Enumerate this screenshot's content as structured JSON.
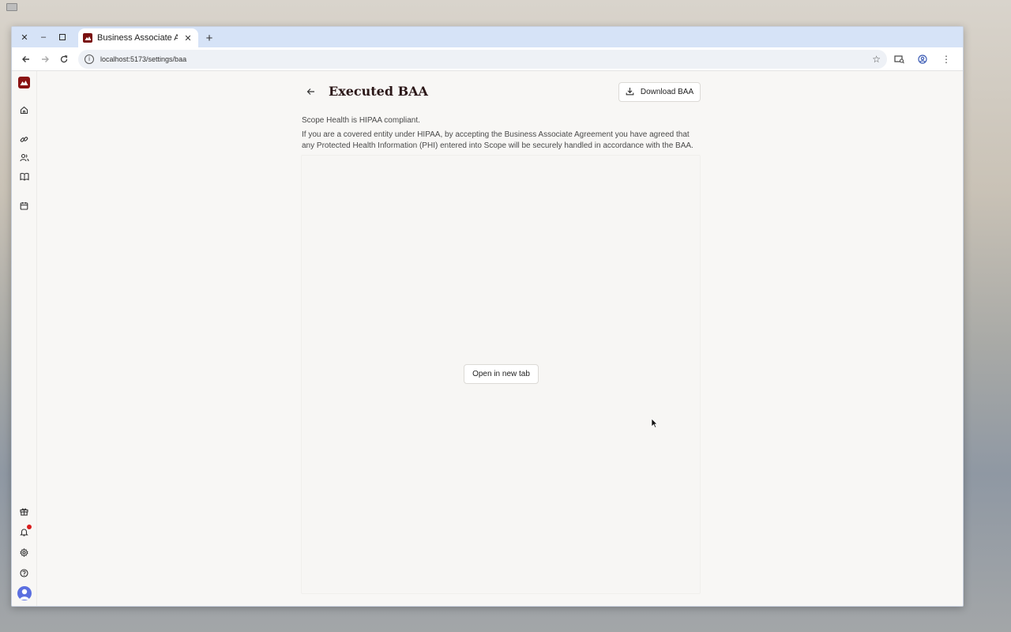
{
  "browser": {
    "tab_title": "Business Associate Agreement",
    "url": "localhost:5173/settings/baa"
  },
  "page": {
    "title": "Executed BAA",
    "download_label": "Download BAA",
    "intro_line1": "Scope Health is HIPAA compliant.",
    "intro_line2": "If you are a covered entity under HIPAA, by accepting the Business Associate Agreement you have agreed that any Protected Health Information (PHI) entered into Scope will be securely handled in accordance with the BAA.",
    "open_new_tab_label": "Open in new tab"
  },
  "sidebar": {
    "top_items": [
      "home-icon",
      "link-icon",
      "users-icon",
      "book-icon",
      "calendar-icon"
    ],
    "bottom_items": [
      "gift-icon",
      "bell-icon",
      "gear-icon",
      "help-icon",
      "avatar"
    ]
  },
  "colors": {
    "brand": "#8a1212",
    "tabstrip": "#d6e3f7",
    "notification": "#d91c1c",
    "avatar": "#5b6fe0"
  }
}
